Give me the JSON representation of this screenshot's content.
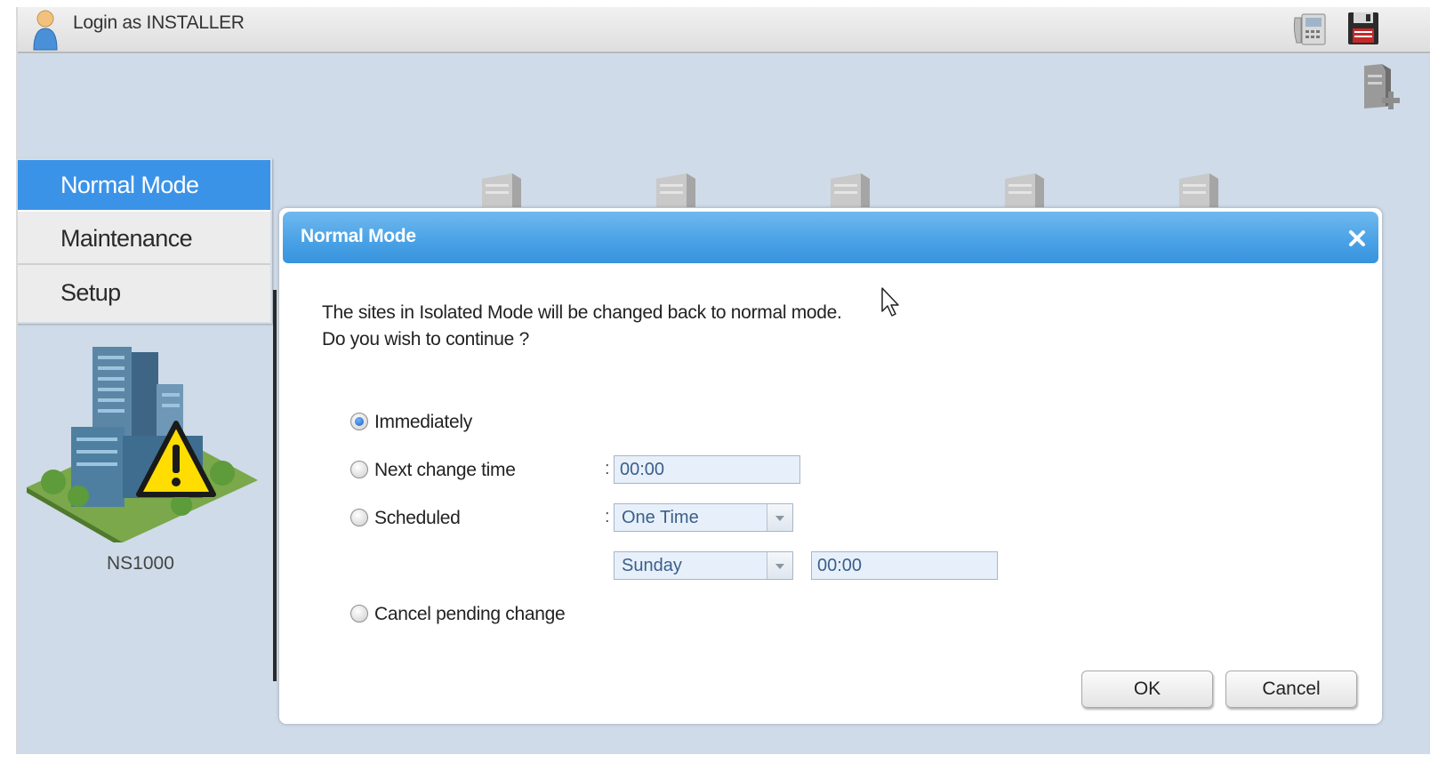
{
  "header": {
    "login_text": "Login as INSTALLER"
  },
  "mode_menu": {
    "items": [
      {
        "label": "Normal Mode",
        "active": true
      },
      {
        "label": "Maintenance",
        "active": false
      },
      {
        "label": "Setup",
        "active": false
      }
    ]
  },
  "site": {
    "name": "NS1000"
  },
  "dialog": {
    "title": "Normal Mode",
    "message_line1": "The sites in Isolated Mode will be changed back to normal mode.",
    "message_line2": "Do you wish to continue ?",
    "options": {
      "immediately": {
        "label": "Immediately",
        "checked": true
      },
      "next_change_time": {
        "label": "Next change time",
        "checked": false,
        "time_value": "00:00"
      },
      "scheduled": {
        "label": "Scheduled",
        "checked": false,
        "frequency": "One Time",
        "day": "Sunday",
        "time_value": "00:00"
      },
      "cancel_pending": {
        "label": "Cancel pending change",
        "checked": false
      }
    },
    "colon": ":",
    "ok_label": "OK",
    "cancel_label": "Cancel"
  },
  "colors": {
    "accent": "#3b93e8",
    "header_blue": "#4ba3e6",
    "workspace": "#cfdbe8"
  }
}
